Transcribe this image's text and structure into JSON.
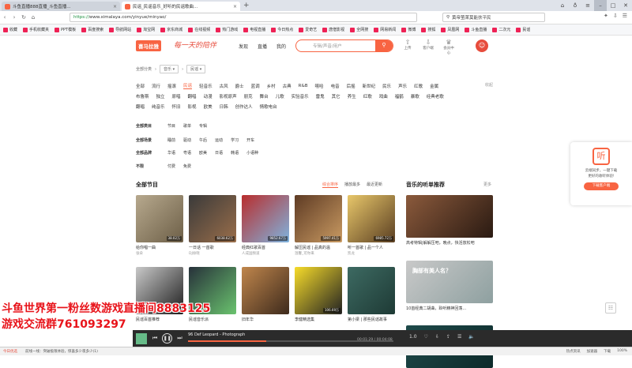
{
  "browser": {
    "tabs": [
      {
        "label": "斗鱼直播888直播_斗鱼直播...",
        "color": "#f86442",
        "active": false
      },
      {
        "label": "民谣_民谣音乐_好听的民谣歌曲...",
        "color": "#f86442",
        "active": true
      }
    ],
    "url_scheme": "https://",
    "url_rest": "www.ximalaya.com/yinyue/minyao/",
    "search_text": "黄帝萤莱莫能扶平民",
    "bookmarks": [
      "收藏",
      "手机收藏夹",
      "PPT模板",
      "百度搜索",
      "导航网站",
      "淘宝网",
      "京东商城",
      "在线视频",
      "热门游戏",
      "电视直播",
      "今日热点",
      "爱奇艺",
      "唐僧影视",
      "全网搜",
      "网易新闻",
      "微博",
      "搜狐",
      "凤凰网",
      "斗鱼直播",
      "二次元",
      "民谣"
    ]
  },
  "site": {
    "logo": "喜马拉雅",
    "slogan": "每一天的陪伴",
    "nav": [
      "发现",
      "直播",
      "我的"
    ],
    "search_placeholder": "专辑/声音/用户",
    "header_icons": [
      {
        "icon": "upload-icon",
        "label": "上传"
      },
      {
        "icon": "download-icon",
        "label": "客户端"
      },
      {
        "icon": "vip-icon",
        "label": "会员中心"
      }
    ]
  },
  "crumb": {
    "category": "全部分类",
    "level1": "音乐",
    "level2": "民谣"
  },
  "filters": {
    "row1": [
      "全部",
      "流行",
      "摇滚",
      "民谣",
      "轻音乐",
      "古风",
      "爵士",
      "蓝调",
      "乡村",
      "古典",
      "R&B",
      "嘻哈",
      "电音",
      "后摇",
      "新世纪",
      "民乐",
      "声乐",
      "红歌",
      "金属"
    ],
    "row1_active": "民谣",
    "row1_more": "收起",
    "row2": [
      "布鲁斯",
      "独立",
      "原唱",
      "翻唱",
      "动漫",
      "影视原声",
      "朋克",
      "舞台",
      "儿歌",
      "实验音乐",
      "雷鬼",
      "其它",
      "养生",
      "红歌",
      "戏曲",
      "福鹤",
      "暴歌",
      "经典老歌"
    ],
    "row3": [
      "翻唱",
      "纯音乐",
      "怀旧",
      "影视",
      "欧美",
      "日韩",
      "创作达人",
      "情歌电台"
    ],
    "props": [
      {
        "label": "全部类目",
        "values": [
          "节目",
          "歌单",
          "专辑"
        ]
      },
      {
        "label": "全部场景",
        "values": [
          "睡前",
          "驱动",
          "午后",
          "运动",
          "学习",
          "开车"
        ]
      },
      {
        "label": "全部品牌",
        "values": [
          "华语",
          "粤语",
          "欧美",
          "日语",
          "韩语",
          "小语种"
        ]
      },
      {
        "label": "不限",
        "values": [
          "付费",
          "免费"
        ]
      }
    ]
  },
  "programs": {
    "title": "全部节目",
    "sorts": [
      "综合排序",
      "播放最多",
      "最近更新"
    ],
    "sorts_active": "综合排序",
    "items": [
      {
        "title": "给你唱一曲",
        "author": "张朵",
        "plays": "38.02万",
        "color1": "#b7a98e",
        "color2": "#6d5f47"
      },
      {
        "title": "一日话 一首歌",
        "author": "DJ徐晓",
        "plays": "6038.62万",
        "color1": "#3a3a3a",
        "color2": "#9a6e4a"
      },
      {
        "title": "经典红歌百首",
        "author": "人成国频道",
        "plays": "9852.67万",
        "color1": "#b92d2d",
        "color2": "#7fb4df"
      },
      {
        "title": "解压民谣 | 品真的温",
        "author": "温馨_可你来",
        "plays": "5997.41万",
        "color1": "#5e3b24",
        "color2": "#c99a62"
      },
      {
        "title": "听一首歌 | 品一个人",
        "author": "凯龙",
        "plays": "6985.72万",
        "color1": "#e8c76a",
        "color2": "#5a3e22"
      },
      {
        "title": "民谣百首推荐",
        "author": "",
        "plays": "",
        "color1": "#c9c9c9",
        "color2": "#1d1d1d"
      },
      {
        "title": "民谣音乐派",
        "author": "",
        "plays": "",
        "color1": "#27313a",
        "color2": "#6ac36e"
      },
      {
        "title": "旧年华",
        "author": "",
        "plays": "",
        "color1": "#c0864c",
        "color2": "#3d2a1c"
      },
      {
        "title": "李健精选集",
        "author": "",
        "plays": "106.69万",
        "color1": "#f7dc2a",
        "color2": "#222222"
      },
      {
        "title": "第小梁 | 那些民谣故事",
        "author": "",
        "plays": "",
        "color1": "#3d6a62",
        "color2": "#1e3a35"
      }
    ]
  },
  "sidebar": {
    "title": "音乐的听单推荐",
    "more": "更多",
    "recs": [
      {
        "caption": "高考特辑|解解压吧，晚点，快活放松吧",
        "color1": "#8b5a3c",
        "color2": "#2a1a12"
      },
      {
        "caption": "10首经典二胡曲，聆听精神回荡...",
        "overlay": "胸部有美人名？",
        "color1": "#c9c9c9",
        "color2": "#8ea0a0"
      },
      {
        "caption": "",
        "color1": "#1e4a4a",
        "color2": "#0d2a2a"
      }
    ]
  },
  "sync_panel": {
    "text1": "云端同步，一键下载",
    "text2": "更好的收听体验!",
    "button": "下载客户端"
  },
  "watermark": {
    "line1": "斗鱼世界第一粉丝数游戏直播间8883125",
    "line2": "游戏交流群761093297"
  },
  "player": {
    "track": "96 Def Leopard - Photograph",
    "time": "00:01:29 / 00:04:08",
    "progress": 0.38,
    "speed": "1.0"
  },
  "status": {
    "left_count": "今日优选",
    "news": "前线一线：突破极限体验，惊喜多少夜多少(1)",
    "right": [
      "热点资讯",
      "加速器",
      "下载",
      "100%"
    ]
  }
}
